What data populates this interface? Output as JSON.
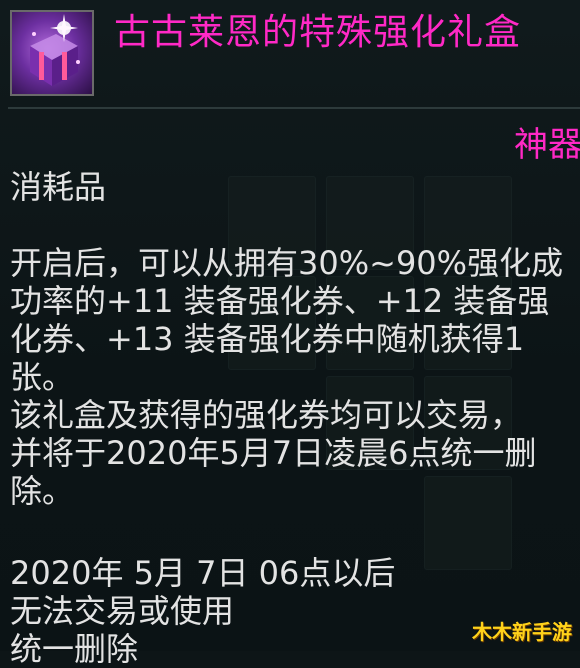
{
  "item": {
    "icon": "gift-box-icon",
    "title": "古古莱恩的特殊强化礼盒"
  },
  "tag_right": "神器",
  "category": "消耗品",
  "description_lines": [
    "开启后，可以从拥有30%~90%强化成",
    "功率的+11 装备强化券、+12 装备强",
    "化券、+13 装备强化券中随机获得1",
    "张。",
    "该礼盒及获得的强化券均可以交易，",
    "并将于2020年5月7日凌晨6点统一删",
    "除。"
  ],
  "expiry_lines": [
    "2020年 5月 7日 06点以后",
    "无法交易或使用",
    "统一删除"
  ],
  "watermark": "木木新手游",
  "colors": {
    "title": "#ff29c6",
    "body_text": "#e3e3e3",
    "background": "#0d1517",
    "watermark": "#ffd21a"
  }
}
